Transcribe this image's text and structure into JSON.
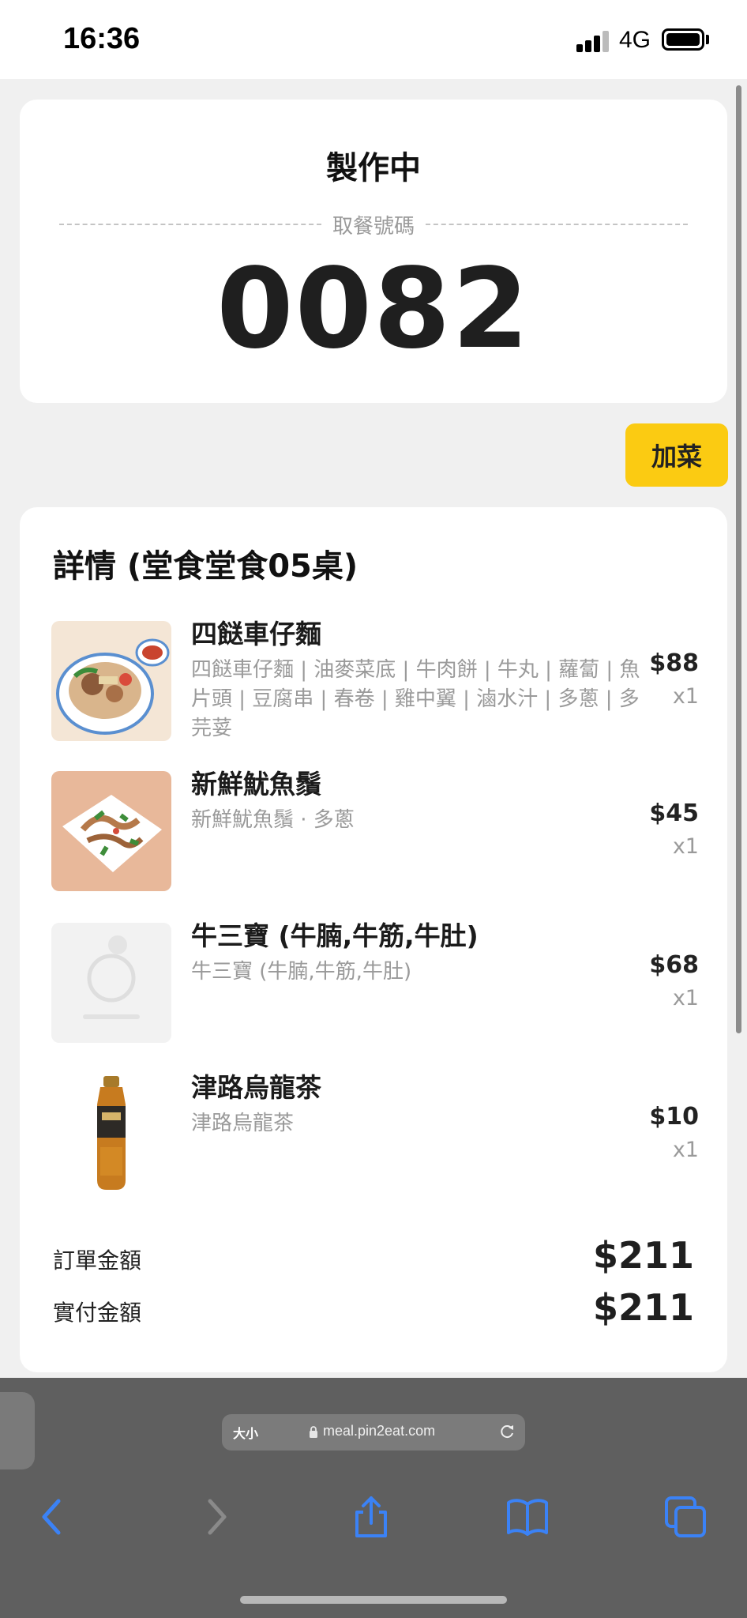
{
  "status_bar": {
    "time": "16:36",
    "network": "4G"
  },
  "order": {
    "status": "製作中",
    "pickup_label": "取餐號碼",
    "pickup_number": "0082"
  },
  "actions": {
    "add_dish_label": "加菜"
  },
  "details": {
    "title": "詳情 (堂食堂食05桌)",
    "items": [
      {
        "name": "四餸車仔麵",
        "description": "四餸車仔麵 | 油麥菜底 | 牛肉餅 | 牛丸 | 蘿蔔 | 魚片頭 | 豆腐串 | 春卷 | 雞中翼 | 滷水汁 | 多蔥 | 多芫荽",
        "price": "$88",
        "qty": "x1",
        "thumb": "noodle-bowl"
      },
      {
        "name": "新鮮魷魚鬚",
        "description": "新鮮魷魚鬚 · 多蔥",
        "price": "$45",
        "qty": "x1",
        "thumb": "squid-plate"
      },
      {
        "name": "牛三寶 (牛腩,牛筋,牛肚)",
        "description": "牛三寶 (牛腩,牛筋,牛肚)",
        "price": "$68",
        "qty": "x1",
        "thumb": "placeholder"
      },
      {
        "name": "津路烏龍茶",
        "description": "津路烏龍茶",
        "price": "$10",
        "qty": "x1",
        "thumb": "tea-bottle"
      }
    ],
    "order_total_label": "訂單金額",
    "order_total": "$211",
    "paid_label": "實付金額",
    "paid_total": "$211"
  },
  "browser": {
    "text_size_label": "大小",
    "url": "meal.pin2eat.com",
    "icons": [
      "back-icon",
      "forward-icon",
      "share-icon",
      "bookmarks-icon",
      "tabs-icon"
    ]
  },
  "colors": {
    "accent": "#fbcb12",
    "background": "#f0f0f0",
    "browser_chrome": "#5f5f5f",
    "toolbar_icon": "#3b82f6"
  }
}
